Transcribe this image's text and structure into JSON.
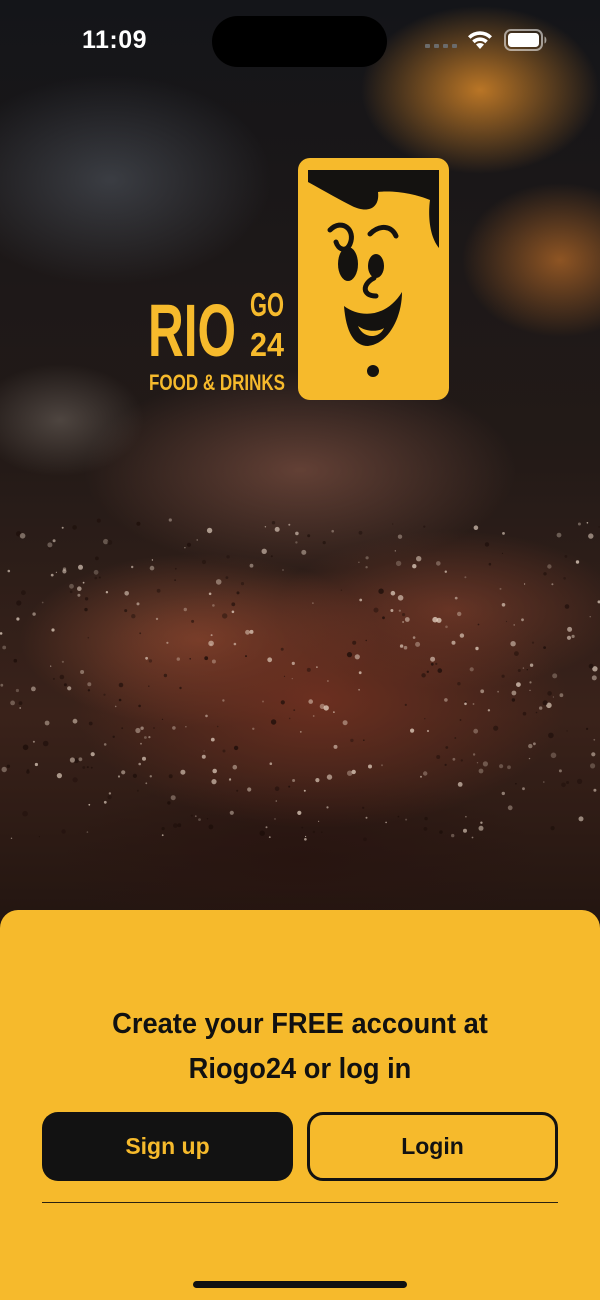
{
  "status_bar": {
    "time": "11:09",
    "icons": [
      "signal-dots-icon",
      "wifi-icon",
      "battery-icon"
    ]
  },
  "logo": {
    "brand": "RIO",
    "sub_top": "GO",
    "sub_bottom": "24",
    "tagline": "FOOD & DRINKS",
    "mascot": "smiling-phone-mascot-icon"
  },
  "onboarding": {
    "headline_line1": "Create your FREE account at",
    "headline_line2": "Riogo24 or log in",
    "signup_label": "Sign up",
    "login_label": "Login"
  },
  "colors": {
    "brand_yellow": "#f6ba2c",
    "dark": "#121212"
  }
}
